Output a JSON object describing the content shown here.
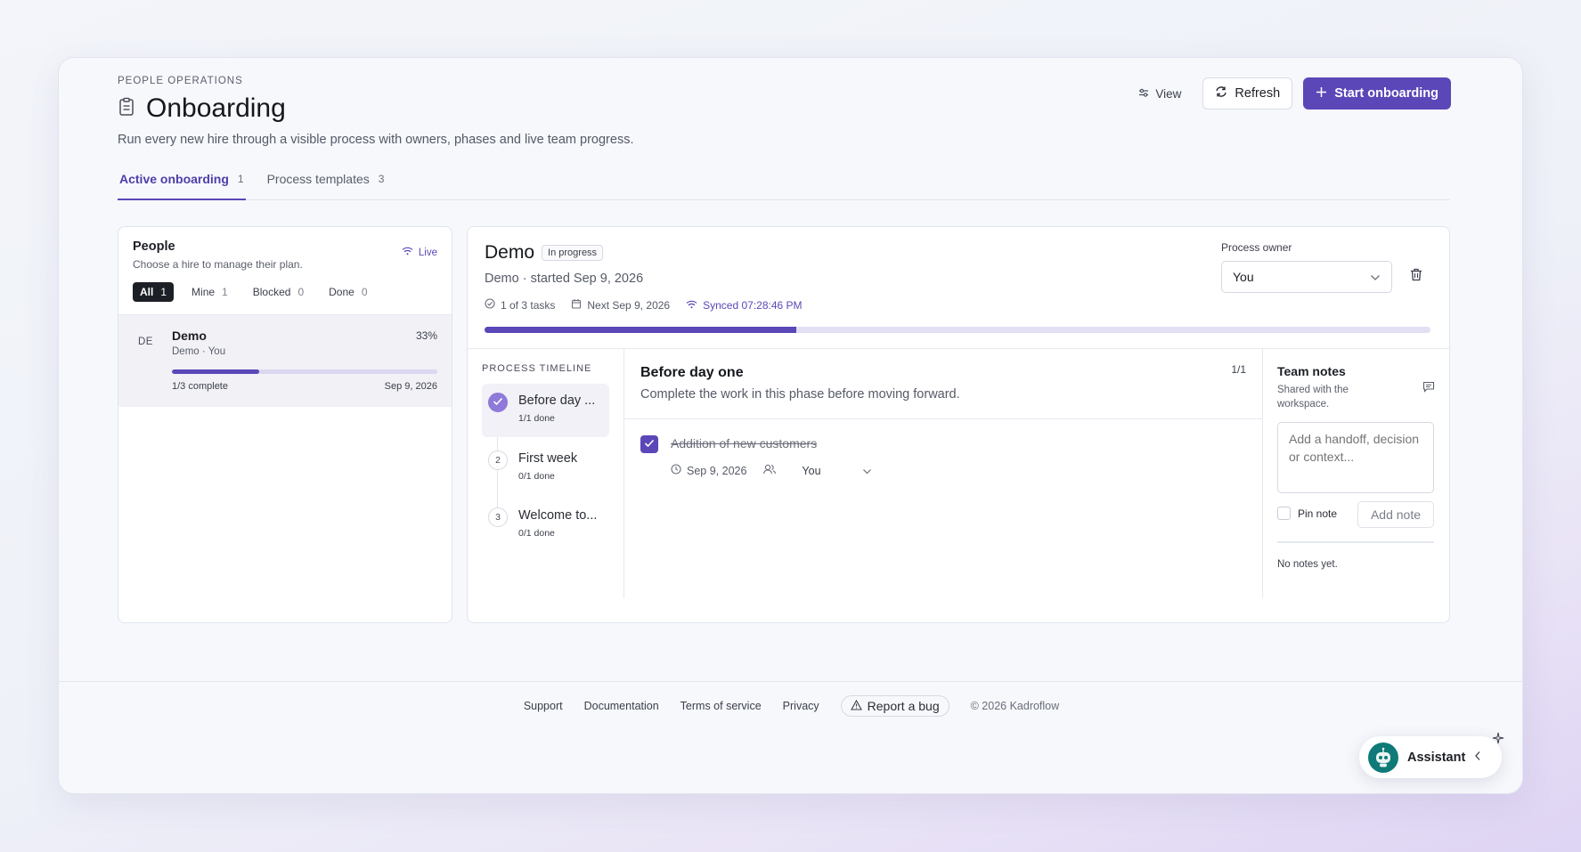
{
  "header": {
    "eyebrow": "PEOPLE OPERATIONS",
    "title": "Onboarding",
    "subtitle": "Run every new hire through a visible process with owners, phases and live team progress.",
    "view_label": "View",
    "refresh_label": "Refresh",
    "start_label": "Start onboarding"
  },
  "tabs": [
    {
      "label": "Active onboarding",
      "count": "1"
    },
    {
      "label": "Process templates",
      "count": "3"
    }
  ],
  "people": {
    "title": "People",
    "subtitle": "Choose a hire to manage their plan.",
    "live_label": "Live",
    "filters": [
      {
        "label": "All",
        "count": "1"
      },
      {
        "label": "Mine",
        "count": "1"
      },
      {
        "label": "Blocked",
        "count": "0"
      },
      {
        "label": "Done",
        "count": "0"
      }
    ],
    "items": [
      {
        "initials": "DE",
        "name": "Demo",
        "sub": "Demo · You",
        "percent_label": "33%",
        "progress": 0.33,
        "complete": "1/3 complete",
        "date": "Sep 9, 2026"
      }
    ]
  },
  "detail": {
    "name": "Demo",
    "status": "In progress",
    "sub": "Demo · started Sep 9, 2026",
    "tasks": "1 of 3 tasks",
    "next": "Next Sep 9, 2026",
    "synced": "Synced 07:28:46 PM",
    "progress": 0.33,
    "owner_label": "Process owner",
    "owner_value": "You"
  },
  "timeline": {
    "label": "PROCESS TIMELINE",
    "phases": [
      {
        "num": "",
        "label": "Before day ...",
        "done": "1/1 done"
      },
      {
        "num": "2",
        "label": "First week",
        "done": "0/1 done"
      },
      {
        "num": "3",
        "label": "Welcome to...",
        "done": "0/1 done"
      }
    ]
  },
  "phase": {
    "title": "Before day one",
    "count": "1/1",
    "sub": "Complete the work in this phase before moving forward.",
    "task": {
      "name": "Addition of new customers",
      "date": "Sep 9, 2026",
      "assignee": "You"
    }
  },
  "notes": {
    "title": "Team notes",
    "sub": "Shared with the workspace.",
    "placeholder": "Add a handoff, decision or context...",
    "pin_label": "Pin note",
    "add_label": "Add note",
    "empty": "No notes yet."
  },
  "footer": {
    "links": [
      "Support",
      "Documentation",
      "Terms of service",
      "Privacy"
    ],
    "bug_label": "Report a bug",
    "copyright": "© 2026 Kadroflow"
  },
  "assistant": {
    "label": "Assistant"
  },
  "colors": {
    "accent": "#5b47b8",
    "accent_light": "#8f7ad9",
    "bot": "#0f7a78"
  }
}
